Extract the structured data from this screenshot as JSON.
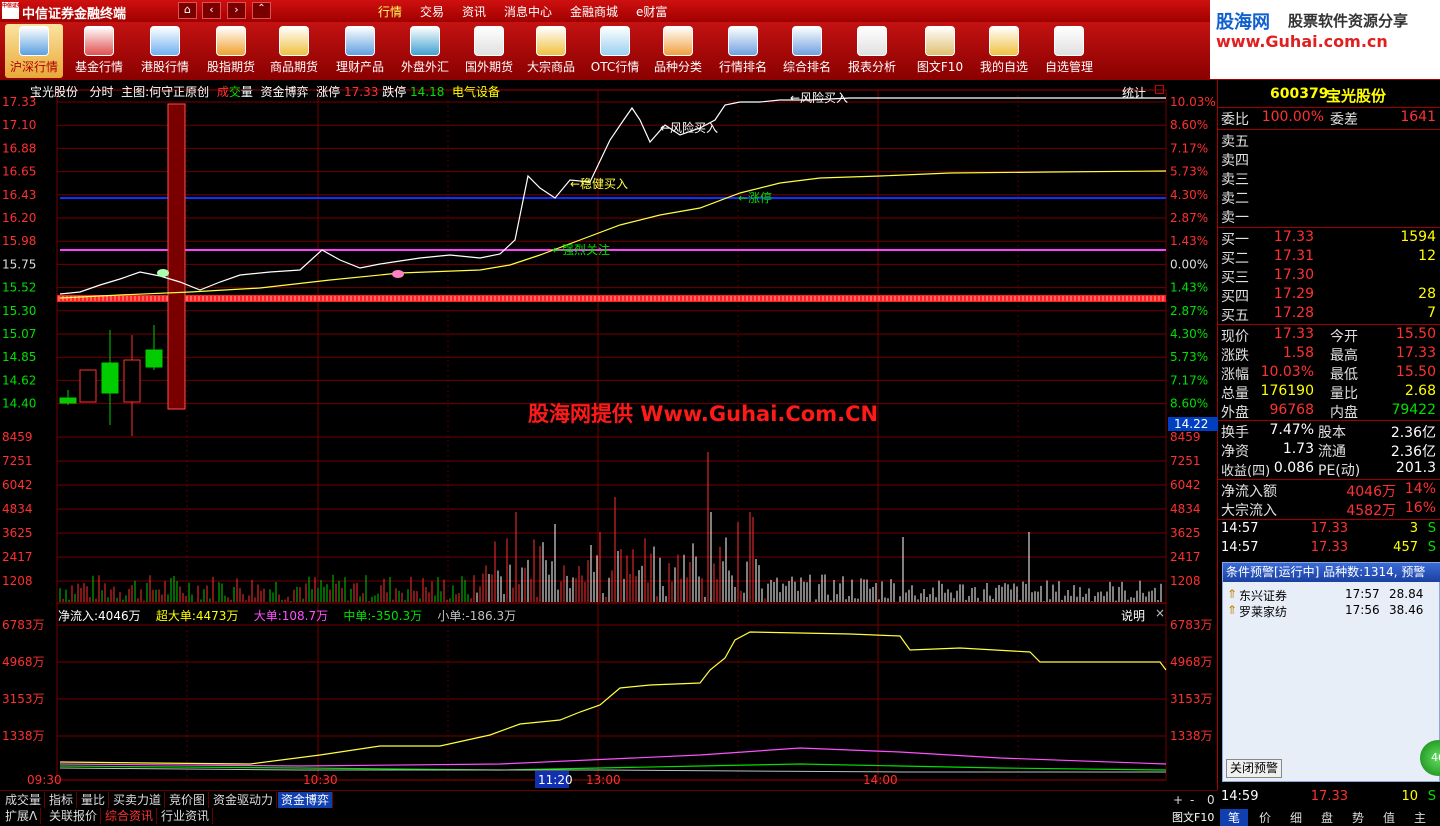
{
  "app": {
    "title": "中信证券金融终端",
    "logo_text": "中信证券"
  },
  "menu": [
    "行情",
    "交易",
    "资讯",
    "消息中心",
    "金融商城",
    "e财富"
  ],
  "brand": {
    "name": "股海网",
    "slogan": "股票软件资源分享",
    "url": "www.Guhai.com.cn"
  },
  "toolbar": [
    "沪深行情",
    "基金行情",
    "港股行情",
    "股指期货",
    "商品期货",
    "理财产品",
    "外盘外汇",
    "国外期货",
    "大宗商品",
    "OTC行情",
    "品种分类",
    "行情排名",
    "综合排名",
    "报表分析",
    "图文F10",
    "我的自选",
    "自选管理"
  ],
  "chart_header": {
    "stock": "宝光股份",
    "mode": "分时",
    "main_label": "主图:何守正原创",
    "cheng": "成",
    "jiao": "交",
    "liang": "量",
    "fund": "资金博弈",
    "zt_label": "涨停",
    "zt_value": "17.33",
    "dt_label": "跌停",
    "dt_value": "14.18",
    "sector": "电气设备",
    "stat": "统计"
  },
  "price_axis_left": [
    "17.33",
    "17.10",
    "16.88",
    "16.65",
    "16.43",
    "16.20",
    "15.98",
    "15.75",
    "15.52",
    "15.30",
    "15.07",
    "14.85",
    "14.62",
    "14.40"
  ],
  "price_axis_right": [
    "10.03%",
    "8.60%",
    "7.17%",
    "5.73%",
    "4.30%",
    "2.87%",
    "1.43%",
    "0.00%",
    "1.43%",
    "2.87%",
    "4.30%",
    "5.73%",
    "7.17%",
    "8.60%"
  ],
  "price_tag": "14.22",
  "annotations": [
    "风险买入",
    "风险买入",
    "稳健买入",
    "涨停",
    "强烈关注"
  ],
  "volume_axis": [
    "8459",
    "7251",
    "6042",
    "4834",
    "3625",
    "2417",
    "1208"
  ],
  "watermark": "股海网提供 Www.Guhai.Com.CN",
  "flow_header": {
    "net": "净流入:4046万",
    "super": "超大单:4473万",
    "big": "大单:108.7万",
    "mid": "中单:-350.3万",
    "small": "小单:-186.3万",
    "explain": "说明",
    "close": "×"
  },
  "flow_axis": [
    "6783万",
    "4968万",
    "3153万",
    "1338万"
  ],
  "time_axis": [
    "09:30",
    "10:30",
    "11:20",
    "13:00",
    "14:00"
  ],
  "bottom_tabs_1": [
    "成交量",
    "指标",
    "量比",
    "买卖力道",
    "竞价图",
    "资金驱动力",
    "资金博弈"
  ],
  "bottom_tabs_2": [
    "扩展ᐱ",
    "关联报价",
    "综合资讯",
    "行业资讯"
  ],
  "bottom_ctrl": [
    "+",
    "-",
    "0"
  ],
  "side": {
    "code": "600379",
    "name": "宝光股份",
    "weibi_label": "委比",
    "weibi": "100.00%",
    "weicha_label": "委差",
    "weicha": "1641",
    "sells": [
      "卖五",
      "卖四",
      "卖三",
      "卖二",
      "卖一"
    ],
    "buys": [
      {
        "label": "买一",
        "price": "17.33",
        "vol": "1594"
      },
      {
        "label": "买二",
        "price": "17.31",
        "vol": "12"
      },
      {
        "label": "买三",
        "price": "17.30",
        "vol": ""
      },
      {
        "label": "买四",
        "price": "17.29",
        "vol": "28"
      },
      {
        "label": "买五",
        "price": "17.28",
        "vol": "7"
      }
    ],
    "quote": [
      {
        "l1": "现价",
        "v1": "17.33",
        "l2": "今开",
        "v2": "15.50"
      },
      {
        "l1": "涨跌",
        "v1": "1.58",
        "l2": "最高",
        "v2": "17.33"
      },
      {
        "l1": "涨幅",
        "v1": "10.03%",
        "l2": "最低",
        "v2": "15.50"
      },
      {
        "l1": "总量",
        "v1": "176190",
        "l2": "量比",
        "v2": "2.68"
      },
      {
        "l1": "外盘",
        "v1": "96768",
        "l2": "内盘",
        "v2": "79422"
      }
    ],
    "fin": [
      {
        "l1": "换手",
        "v1": "7.47%",
        "l2": "股本",
        "v2": "2.36亿"
      },
      {
        "l1": "净资",
        "v1": "1.73",
        "l2": "流通",
        "v2": "2.36亿"
      },
      {
        "l1": "收益(四)",
        "v1": "0.086",
        "l2": "PE(动)",
        "v2": "201.3"
      }
    ],
    "flow": [
      {
        "l": "净流入额",
        "v": "4046万",
        "p": "14%"
      },
      {
        "l": "大宗流入",
        "v": "4582万",
        "p": "16%"
      }
    ],
    "ticks": [
      {
        "time": "14:57",
        "price": "17.33",
        "vol": "3",
        "bs": "S"
      },
      {
        "time": "14:57",
        "price": "17.33",
        "vol": "457",
        "bs": "S"
      }
    ],
    "alert_title": "条件预警[运行中] 品种数:1314, 预警",
    "alerts": [
      {
        "name": "东兴证券",
        "time": "17:57",
        "val": "28.84"
      },
      {
        "name": "罗莱家纺",
        "time": "17:56",
        "val": "38.46"
      }
    ],
    "alert_close": "关闭预警",
    "last_tick": {
      "time": "14:59",
      "price": "17.33",
      "vol": "10",
      "bs": "S"
    },
    "bottom_tabs": [
      "笔",
      "价",
      "细",
      "盘",
      "势",
      "值",
      "主"
    ],
    "f10": "图文F10",
    "circle": "46"
  }
}
